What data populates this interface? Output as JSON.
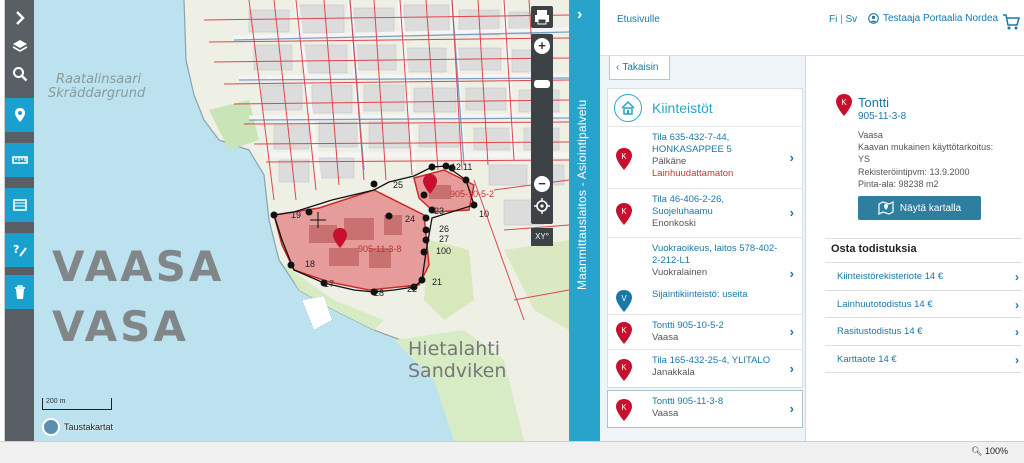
{
  "toolbar": {
    "buttons": [
      {
        "icon": "chevron-right-icon"
      },
      {
        "icon": "layers-icon"
      },
      {
        "icon": "search-icon"
      },
      {
        "icon": "location-pin-icon"
      },
      {
        "icon": "ruler-icon"
      },
      {
        "icon": "area-measure-icon"
      },
      {
        "icon": "help-tool-icon"
      },
      {
        "icon": "trash-icon"
      }
    ]
  },
  "map": {
    "city_fi": "VAASA",
    "city_sv": "VASA",
    "place_1": "Raatalinsaari",
    "place_2": "Skräddargrund",
    "district_fi": "Hietalahti",
    "district_sv": "Sandviken",
    "parcel_1": "905-11-3-8",
    "parcel_2": "905-10-5-2",
    "points": [
      "19",
      "25",
      "24",
      "23",
      "26",
      "27",
      "10",
      "100",
      "18",
      "17",
      "28",
      "22",
      "21",
      "12",
      "11"
    ],
    "scale": "200 m",
    "background_maps": "Taustakartat",
    "xy": "XY°"
  },
  "service_bar": {
    "text": "Maanmittauslaitos - Asiointipalvelu"
  },
  "header": {
    "front_page": "Etusivulle",
    "lang_fi": "Fi",
    "lang_sep": "|",
    "lang_sv": "Sv",
    "user": "Testaaja Portaalia Nordea"
  },
  "results": {
    "back": "Takaisin",
    "title": "Kiinteistöt",
    "items": [
      {
        "badge": "K",
        "title": "Tila 635-432-7-44, HONKASAPPEE 5",
        "sub": "Pälkäne",
        "sub2": "Lainhuudattamaton"
      },
      {
        "badge": "K",
        "title": "Tila 46-406-2-26, Suojeluhaamu",
        "sub": "Enonkoski"
      },
      {
        "badge": "",
        "title": "Vuokraoikeus, laitos 578-402-2-212-L1",
        "sub": "Vuokralainen"
      },
      {
        "badge": "V",
        "title": "Sijaintikiinteistö: useita",
        "sub": ""
      },
      {
        "badge": "K",
        "title": "Tontti 905-10-5-2",
        "sub": "Vaasa"
      },
      {
        "badge": "K",
        "title": "Tila 165-432-25-4, YLITALO",
        "sub": "Janakkala"
      }
    ],
    "selected": {
      "badge": "K",
      "title": "Tontti 905-11-3-8",
      "sub": "Vaasa"
    }
  },
  "details": {
    "badge": "K",
    "title": "Tontti",
    "id": "905-11-3-8",
    "municipality": "Vaasa",
    "usage_label": "Kaavan mukainen käyttötarkoitus:",
    "usage_value": "YS",
    "reg_date": "Rekisteröintipvm: 13.9.2000",
    "area": "Pinta-ala: 98238 m2",
    "show_on_map": "Näytä kartalla",
    "buy_title": "Osta todistuksia",
    "certificates": [
      "Kiinteistörekisteriote 14 €",
      "Lainhuutotodistus 14 €",
      "Rasitustodistus 14 €",
      "Karttaote 14 €"
    ]
  },
  "statusbar": {
    "zoom": "100%"
  },
  "colors": {
    "accent": "#28a4cc",
    "toolbar": "#5a5f66",
    "link": "#1a78a8",
    "pin_red": "#c8102e",
    "pin_blue": "#1a78a8"
  }
}
